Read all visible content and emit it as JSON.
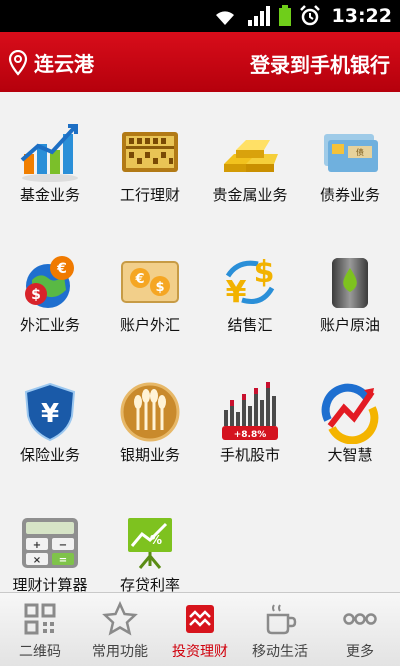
{
  "status_bar": {
    "time": "13:22"
  },
  "header": {
    "city": "连云港",
    "login_label": "登录到手机银行"
  },
  "grid_items": [
    {
      "label": "基金业务",
      "icon": "fund-chart-icon"
    },
    {
      "label": "工行理财",
      "icon": "abacus-icon"
    },
    {
      "label": "贵金属业务",
      "icon": "gold-bars-icon"
    },
    {
      "label": "债券业务",
      "icon": "bond-icon"
    },
    {
      "label": "外汇业务",
      "icon": "globe-currency-icon"
    },
    {
      "label": "账户外汇",
      "icon": "coins-exchange-icon"
    },
    {
      "label": "结售汇",
      "icon": "yen-dollar-exchange-icon"
    },
    {
      "label": "账户原油",
      "icon": "oil-barrel-icon"
    },
    {
      "label": "保险业务",
      "icon": "yuan-shield-icon"
    },
    {
      "label": "银期业务",
      "icon": "wheat-coin-icon"
    },
    {
      "label": "手机股市",
      "icon": "stock-chart-icon",
      "badge": "+8.8%"
    },
    {
      "label": "大智慧",
      "icon": "dazhihui-logo-icon"
    },
    {
      "label": "理财计算器",
      "icon": "calculator-icon"
    },
    {
      "label": "存贷利率",
      "icon": "rate-board-icon"
    }
  ],
  "bottom_nav": [
    {
      "label": "二维码",
      "icon": "qr-code-icon"
    },
    {
      "label": "常用功能",
      "icon": "star-icon"
    },
    {
      "label": "投资理财",
      "icon": "investment-icon",
      "active": true
    },
    {
      "label": "移动生活",
      "icon": "coffee-cup-icon"
    },
    {
      "label": "更多",
      "icon": "more-dots-icon"
    }
  ],
  "colors": {
    "header_red": "#c8000f",
    "active_red": "#d0000c"
  }
}
